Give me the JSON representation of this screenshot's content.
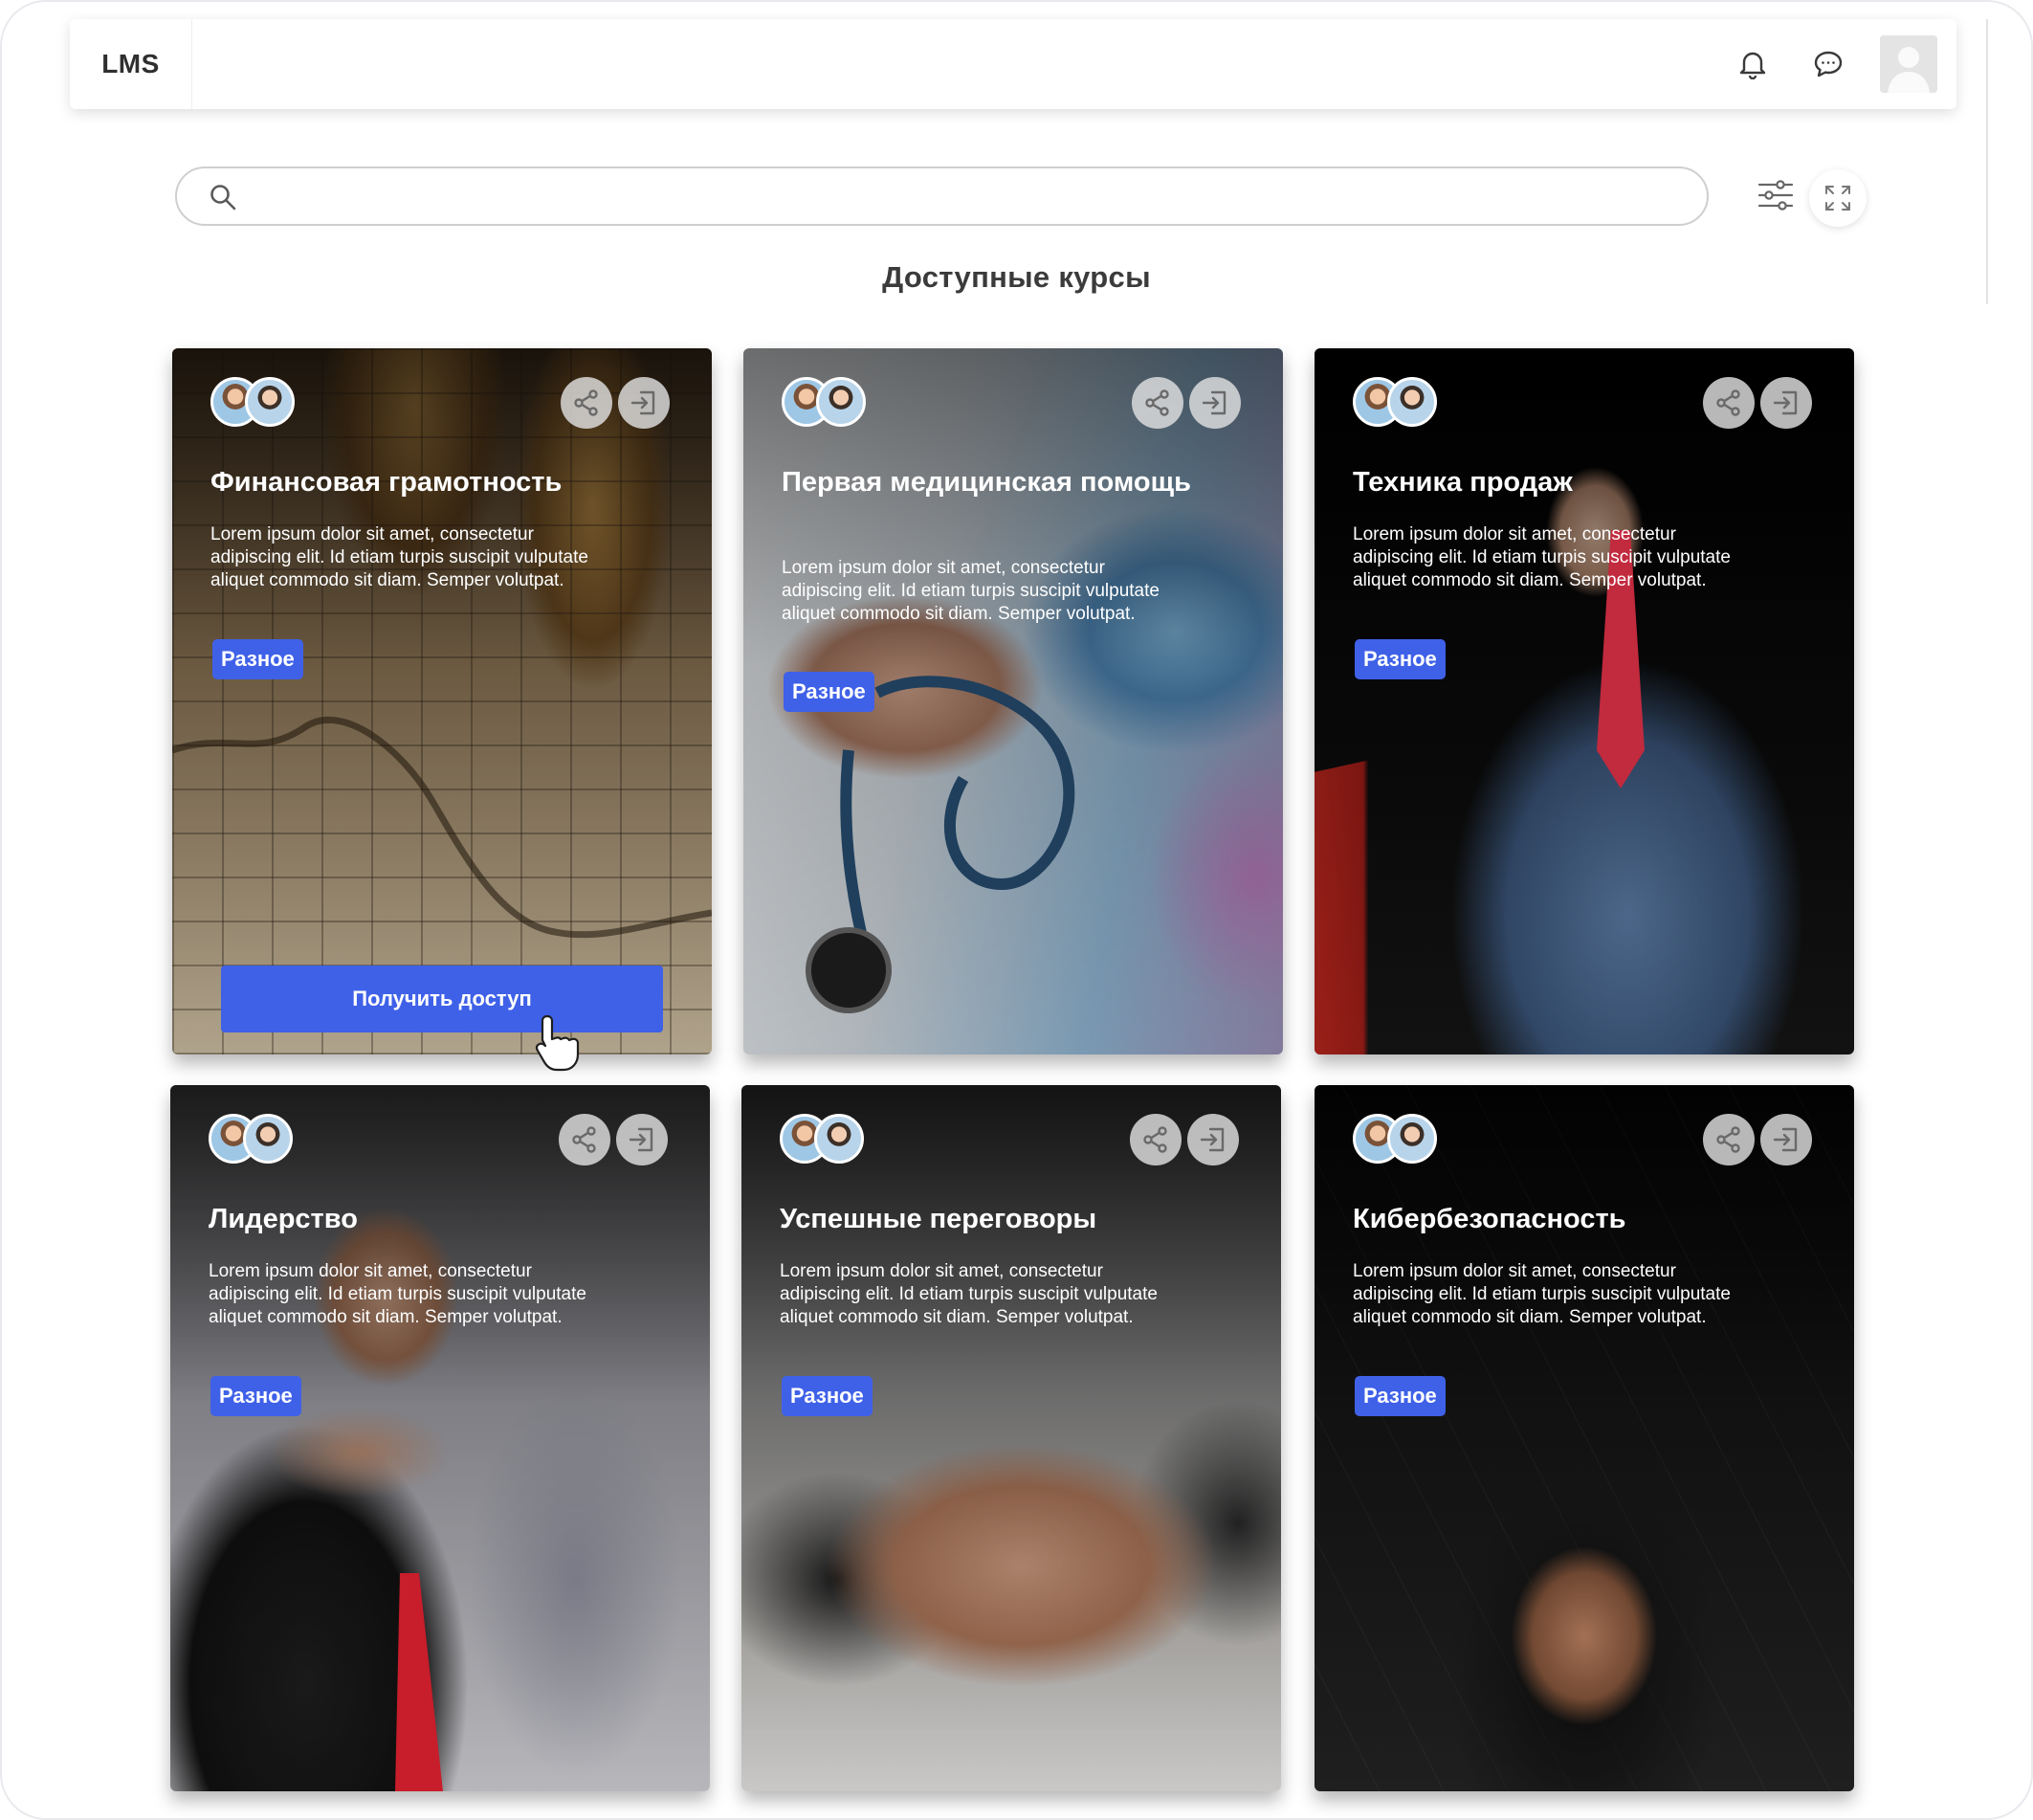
{
  "header": {
    "logo": "LMS",
    "icons": [
      "bell-icon",
      "chat-icon",
      "user-avatar"
    ]
  },
  "search": {
    "value": "",
    "placeholder": ""
  },
  "page": {
    "title": "Доступные курсы"
  },
  "colors": {
    "accent": "#3f61e8",
    "text_dark": "#2f2f2f"
  },
  "courses": [
    {
      "title": "Финансовая грамотность",
      "description": "Lorem ipsum dolor sit amet, consectetur adipiscing elit. Id etiam turpis suscipit vulputate aliquet commodo sit diam. Semper volutpat.",
      "tag": "Разное",
      "cta": "Получить доступ"
    },
    {
      "title": "Первая медицинская помощь",
      "description": "Lorem ipsum dolor sit amet, consectetur adipiscing elit. Id etiam turpis suscipit vulputate aliquet commodo sit diam. Semper volutpat.",
      "tag": "Разное"
    },
    {
      "title": "Техника продаж",
      "description": "Lorem ipsum dolor sit amet, consectetur adipiscing elit. Id etiam turpis suscipit vulputate aliquet commodo sit diam. Semper volutpat.",
      "tag": "Разное"
    },
    {
      "title": "Лидерство",
      "description": "Lorem ipsum dolor sit amet, consectetur adipiscing elit. Id etiam turpis suscipit vulputate aliquet commodo sit diam. Semper volutpat.",
      "tag": "Разное"
    },
    {
      "title": "Успешные переговоры",
      "description": "Lorem ipsum dolor sit amet, consectetur adipiscing elit. Id etiam turpis suscipit vulputate aliquet commodo sit diam. Semper volutpat.",
      "tag": "Разное"
    },
    {
      "title": "Кибербезопасность",
      "description": "Lorem ipsum dolor sit amet, consectetur adipiscing elit. Id etiam turpis suscipit vulputate aliquet commodo sit diam. Semper volutpat.",
      "tag": "Разное"
    }
  ]
}
